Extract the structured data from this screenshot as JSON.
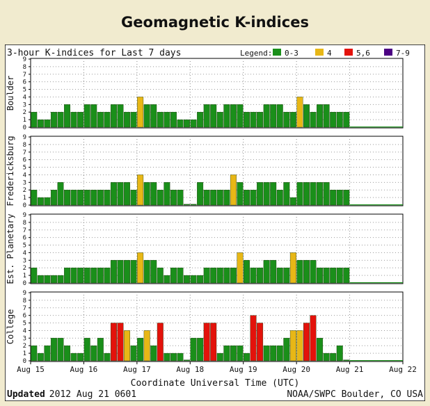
{
  "page": {
    "title": "Geomagnetic K-indices"
  },
  "chart_data": {
    "type": "bar",
    "title": "3-hour K-indices for Last 7 days",
    "legend": {
      "title": "Legend:",
      "placement": "top-right",
      "items": [
        {
          "label": "0-3",
          "color": "#1a8f1a"
        },
        {
          "label": "4",
          "color": "#e8b716"
        },
        {
          "label": "5,6",
          "color": "#e3120b"
        },
        {
          "label": "7-9",
          "color": "#4b0082"
        }
      ]
    },
    "ylim": [
      0,
      9
    ],
    "yticks": [
      "0",
      "1",
      "2",
      "3",
      "4",
      "5",
      "6",
      "7",
      "8",
      "9"
    ],
    "xlabel": "Coordinate Universal Time (UTC)",
    "x_ticks": [
      "Aug 15",
      "Aug 16",
      "Aug 17",
      "Aug 18",
      "Aug 19",
      "Aug 20",
      "Aug 21",
      "Aug 22"
    ],
    "grid": true,
    "bars_per_day": 8,
    "series": [
      {
        "name": "Boulder",
        "values": [
          2,
          1,
          1,
          2,
          2,
          3,
          2,
          2,
          3,
          3,
          2,
          2,
          3,
          3,
          2,
          2,
          4,
          3,
          3,
          2,
          2,
          2,
          1,
          1,
          1,
          2,
          3,
          3,
          2,
          3,
          3,
          3,
          2,
          2,
          2,
          3,
          3,
          3,
          2,
          2,
          4,
          3,
          2,
          3,
          3,
          2,
          2,
          2
        ]
      },
      {
        "name": "Fredericksburg",
        "values": [
          2,
          1,
          1,
          2,
          3,
          2,
          2,
          2,
          2,
          2,
          2,
          2,
          3,
          3,
          3,
          2,
          4,
          3,
          3,
          2,
          3,
          2,
          2,
          0,
          0,
          3,
          2,
          2,
          2,
          2,
          4,
          3,
          2,
          2,
          3,
          3,
          3,
          2,
          3,
          1,
          3,
          3,
          3,
          3,
          3,
          2,
          2,
          2
        ]
      },
      {
        "name": "Est. Planetary",
        "values": [
          2,
          1,
          1,
          1,
          1,
          2,
          2,
          2,
          2,
          2,
          2,
          2,
          3,
          3,
          3,
          3,
          4,
          3,
          3,
          2,
          1,
          2,
          2,
          1,
          1,
          1,
          2,
          2,
          2,
          2,
          2,
          4,
          3,
          2,
          2,
          3,
          3,
          2,
          2,
          4,
          3,
          3,
          3,
          2,
          2,
          2,
          2,
          2
        ]
      },
      {
        "name": "College",
        "values": [
          2,
          1,
          2,
          3,
          3,
          2,
          1,
          1,
          3,
          2,
          3,
          1,
          5,
          5,
          4,
          2,
          3,
          4,
          2,
          5,
          1,
          1,
          1,
          0,
          3,
          3,
          5,
          5,
          1,
          2,
          2,
          2,
          1,
          6,
          5,
          2,
          2,
          2,
          3,
          4,
          4,
          5,
          6,
          3,
          1,
          1,
          2,
          0
        ]
      }
    ],
    "footer": {
      "updated_label": "Updated",
      "updated_value": "2012 Aug 21 0601",
      "credit": "NOAA/SWPC Boulder, CO USA"
    }
  }
}
